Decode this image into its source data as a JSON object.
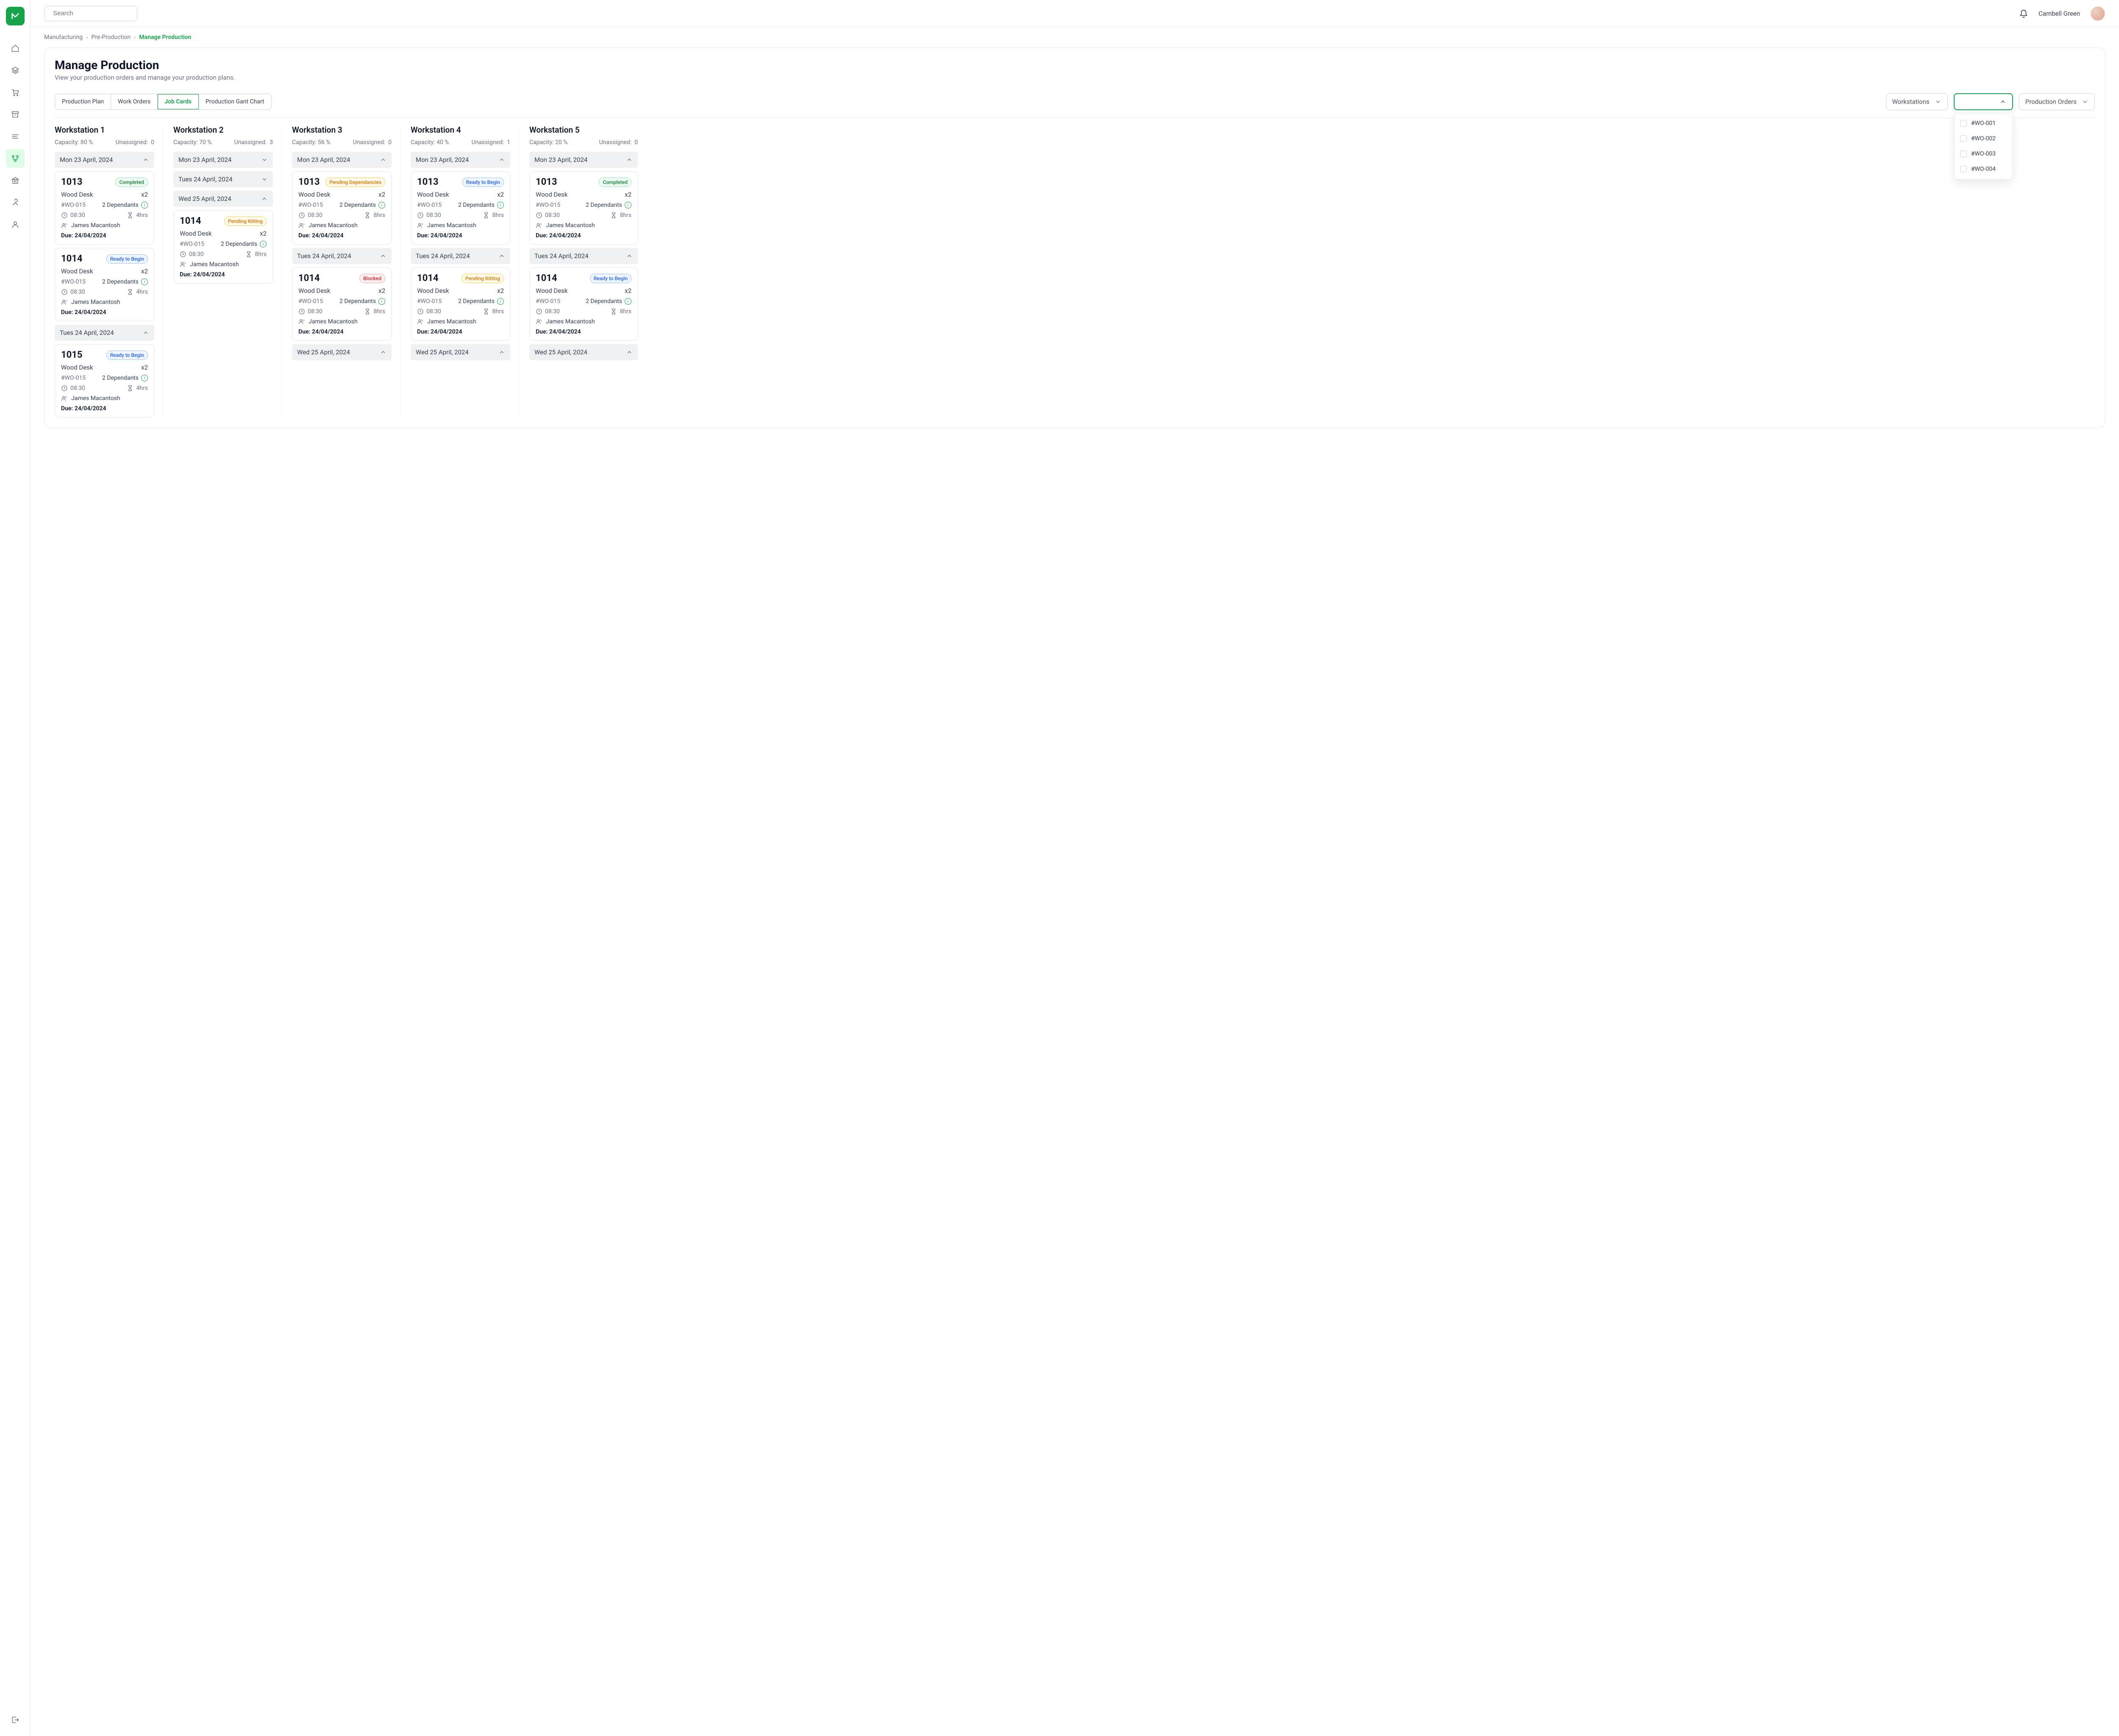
{
  "search_placeholder": "Search",
  "user_name": "Cambell Green",
  "breadcrumb": {
    "a": "Manufacturing",
    "b": "Pre-Production",
    "c": "Manage Production"
  },
  "page": {
    "title": "Manage Production",
    "subtitle": "View your production orders and manage your production plans."
  },
  "tabs": {
    "t0": "Production Plan",
    "t1": "Work Orders",
    "t2": "Job Cards",
    "t3": "Production Gant Chart"
  },
  "filter_workstations": "Workstations",
  "filter_production": "Production Orders",
  "dropdown": {
    "d0": "#WO-001",
    "d1": "#WO-002",
    "d2": "#WO-003",
    "d3": "#WO-004"
  },
  "capacity_label": "Capacity: ",
  "unassigned_label": "Unassigned:",
  "due_label": "Due: ",
  "dep_label": "2 Dependants",
  "columns": [
    {
      "name": "Workstation 1",
      "capacity": "80 %",
      "unassigned": "0",
      "groups": [
        {
          "date": "Mon 23 April, 2024",
          "open": true,
          "cards": [
            {
              "id": "1013",
              "status": "Completed",
              "statusClass": "completed",
              "product": "Wood Desk",
              "qty": "x2",
              "wo": "#WO-015",
              "time": "08:30",
              "dur": "4hrs",
              "assignee": "James Macantosh",
              "due": "24/04/2024"
            },
            {
              "id": "1014",
              "status": "Ready to Begin",
              "statusClass": "ready",
              "product": "Wood Desk",
              "qty": "x2",
              "wo": "#WO-015",
              "time": "08:30",
              "dur": "4hrs",
              "assignee": "James Macantosh",
              "due": "24/04/2024"
            }
          ]
        },
        {
          "date": "Tues 24 April, 2024",
          "open": true,
          "cards": [
            {
              "id": "1015",
              "status": "Ready to Begin",
              "statusClass": "ready",
              "product": "Wood Desk",
              "qty": "x2",
              "wo": "#WO-015",
              "time": "08:30",
              "dur": "4hrs",
              "assignee": "James Macantosh",
              "due": "24/04/2024"
            }
          ]
        }
      ]
    },
    {
      "name": "Workstation 2",
      "capacity": "70 %",
      "unassigned": "3",
      "groups": [
        {
          "date": "Mon 23 April, 2024",
          "open": false,
          "cards": []
        },
        {
          "date": "Tues 24 April, 2024",
          "open": false,
          "cards": []
        },
        {
          "date": "Wed 25 April, 2024",
          "open": true,
          "cards": [
            {
              "id": "1014",
              "status": "Pending Kitting",
              "statusClass": "pending-kit",
              "product": "Wood Desk",
              "qty": "x2",
              "wo": "#WO-015",
              "time": "08:30",
              "dur": "8hrs",
              "assignee": "James Macantosh",
              "due": "24/04/2024"
            }
          ]
        }
      ]
    },
    {
      "name": "Workstation 3",
      "capacity": "56 %",
      "unassigned": "0",
      "groups": [
        {
          "date": "Mon 23 April, 2024",
          "open": true,
          "cards": [
            {
              "id": "1013",
              "status": "Pending Dependancies",
              "statusClass": "pending-dep",
              "product": "Wood Desk",
              "qty": "x2",
              "wo": "#WO-015",
              "time": "08:30",
              "dur": "8hrs",
              "assignee": "James Macantosh",
              "due": "24/04/2024"
            }
          ]
        },
        {
          "date": "Tues 24 April, 2024",
          "open": true,
          "cards": [
            {
              "id": "1014",
              "status": "Blocked",
              "statusClass": "blocked",
              "product": "Wood Desk",
              "qty": "x2",
              "wo": "#WO-015",
              "time": "08:30",
              "dur": "8hrs",
              "assignee": "James Macantosh",
              "due": "24/04/2024"
            }
          ]
        },
        {
          "date": "Wed 25 April, 2024",
          "open": true,
          "cards": []
        }
      ]
    },
    {
      "name": "Workstation 4",
      "capacity": "40 %",
      "unassigned": "1",
      "groups": [
        {
          "date": "Mon 23 April, 2024",
          "open": true,
          "cards": [
            {
              "id": "1013",
              "status": "Ready to Begin",
              "statusClass": "ready",
              "product": "Wood Desk",
              "qty": "x2",
              "wo": "#WO-015",
              "time": "08:30",
              "dur": "8hrs",
              "assignee": "James Macantosh",
              "due": "24/04/2024"
            }
          ]
        },
        {
          "date": "Tues 24 April, 2024",
          "open": true,
          "cards": [
            {
              "id": "1014",
              "status": "Pending Kitting",
              "statusClass": "pending-kit",
              "product": "Wood Desk",
              "qty": "x2",
              "wo": "#WO-015",
              "time": "08:30",
              "dur": "8hrs",
              "assignee": "James Macantosh",
              "due": "24/04/2024"
            }
          ]
        },
        {
          "date": "Wed 25 April, 2024",
          "open": true,
          "cards": []
        }
      ]
    },
    {
      "name": "Workstation 5",
      "capacity": "20 %",
      "unassigned": "0",
      "groups": [
        {
          "date": "Mon 23 April, 2024",
          "open": true,
          "cards": [
            {
              "id": "1013",
              "status": "Completed",
              "statusClass": "completed",
              "product": "Wood Desk",
              "qty": "x2",
              "wo": "#WO-015",
              "time": "08:30",
              "dur": "8hrs",
              "assignee": "James Macantosh",
              "due": "24/04/2024"
            }
          ]
        },
        {
          "date": "Tues 24 April, 2024",
          "open": true,
          "cards": [
            {
              "id": "1014",
              "status": "Ready to Begin",
              "statusClass": "ready",
              "product": "Wood Desk",
              "qty": "x2",
              "wo": "#WO-015",
              "time": "08:30",
              "dur": "8hrs",
              "assignee": "James Macantosh",
              "due": "24/04/2024"
            }
          ]
        },
        {
          "date": "Wed 25 April, 2024",
          "open": true,
          "cards": []
        }
      ]
    }
  ]
}
